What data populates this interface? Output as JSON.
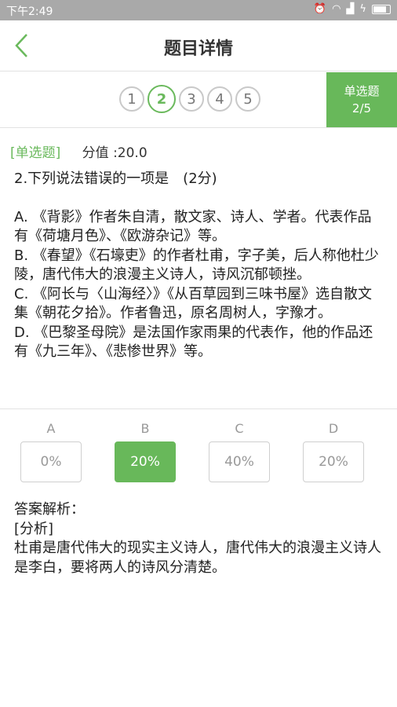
{
  "status": {
    "time": "下午2:49"
  },
  "header": {
    "title": "题目详情"
  },
  "nav": {
    "numbers": [
      "1",
      "2",
      "3",
      "4",
      "5"
    ],
    "current_index": 1,
    "type_label": "单选题",
    "progress": "2/5"
  },
  "meta": {
    "tag": "[单选题]",
    "score": "分值 :20.0"
  },
  "question": {
    "stem": "2.下列说法错误的一项是　(2分)",
    "options": [
      "A. 《背影》作者朱自清，散文家、诗人、学者。代表作品有《荷塘月色》、《欧游杂记》等。",
      "B. 《春望》《石壕吏》的作者杜甫，字子美，后人称他杜少陵，唐代伟大的浪漫主义诗人，诗风沉郁顿挫。",
      "C. 《阿长与〈山海经〉》《从百草园到三味书屋》选自散文集《朝花夕拾》。作者鲁迅，原名周树人，字豫才。",
      "D. 《巴黎圣母院》是法国作家雨果的代表作，他的作品还有《九三年》、《悲惨世界》等。"
    ]
  },
  "stats": [
    {
      "letter": "A",
      "value": "0%",
      "highlight": false
    },
    {
      "letter": "B",
      "value": "20%",
      "highlight": true
    },
    {
      "letter": "C",
      "value": "40%",
      "highlight": false
    },
    {
      "letter": "D",
      "value": "20%",
      "highlight": false
    }
  ],
  "analysis": {
    "title": "答案解析：",
    "tag": "[分析]",
    "text": "杜甫是唐代伟大的现实主义诗人，唐代伟大的浪漫主义诗人是李白，要将两人的诗风分清楚。"
  },
  "colors": {
    "accent": "#68b85a",
    "statusbar": "#a9a9a9"
  }
}
